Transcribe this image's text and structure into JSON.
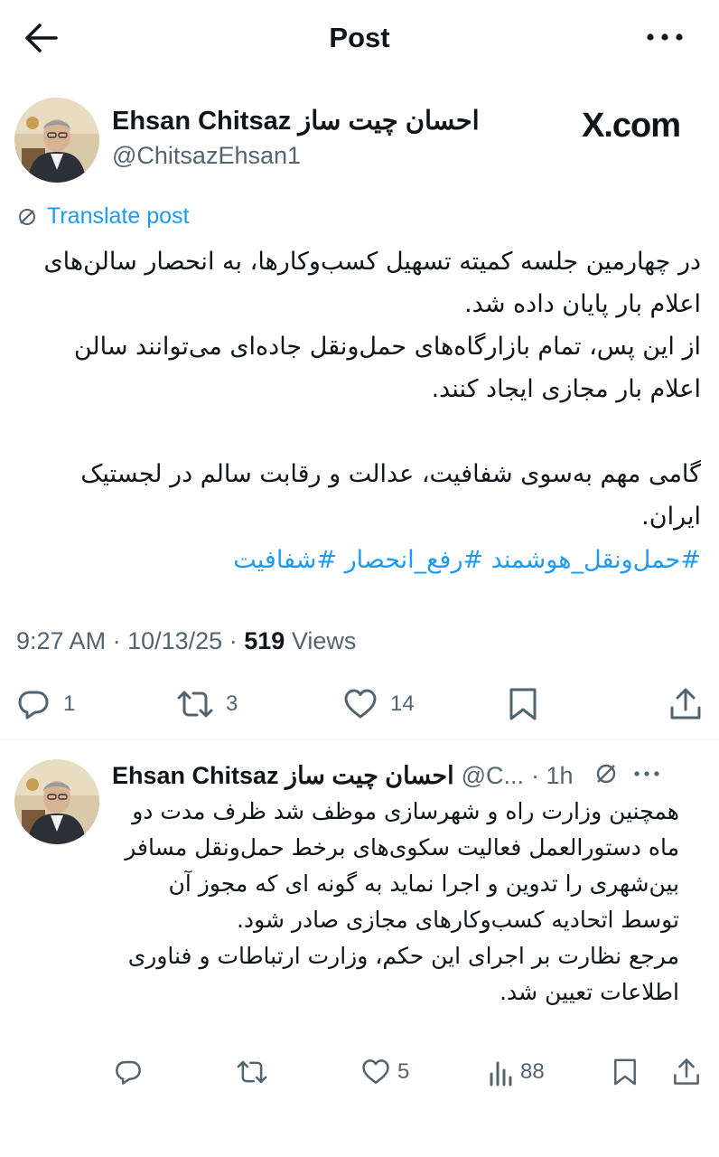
{
  "header": {
    "title": "Post"
  },
  "watermark": "X.com",
  "post": {
    "author_name": "Ehsan Chitsaz احسان چیت ساز",
    "author_handle": "@ChitsazEhsan1",
    "translate_label": "Translate post",
    "text": "در چهارمین جلسه کمیته تسهیل کسب‌وکارها، به انحصار سالن‌های اعلام بار پایان داده شد.\nاز این پس، تمام بازارگاه‌های حمل‌ونقل جاده‌ای می‌توانند سالن  اعلام بار مجازی ایجاد کنند.\n\nگامی مهم به‌سوی شفافیت، عدالت و رقابت سالم در لجستیک ایران.",
    "hashtags": [
      "#حمل‌ونقل_هوشمند",
      "#رفع_انحصار",
      "#شفافیت"
    ],
    "time": "9:27 AM",
    "date": "10/13/25",
    "views_count": "519",
    "views_label": "Views",
    "sep": "·",
    "replies": "1",
    "reposts": "3",
    "likes": "14"
  },
  "reply": {
    "author_name": "Ehsan Chitsaz احسان چیت ساز",
    "author_handle": "@C...",
    "time_ago": "· 1h",
    "text": "همچنین وزارت راه و شهرسازی موظف شد ظرف مدت دو ماه دستورالعمل فعالیت سکوی‌های برخط حمل‌ونقل مسافر بین‌شهری را تدوین و اجرا نماید به گونه ای که مجوز آن  توسط اتحادیه کسب‌وکارهای مجازی صادر شود.\nمرجع نظارت بر اجرای این حکم، وزارت ارتباطات و فناوری اطلاعات تعیین شد.",
    "replies": "",
    "reposts": "",
    "likes": "5",
    "views": "88"
  },
  "colors": {
    "accent": "#1d9bf0",
    "muted": "#536471",
    "text": "#0f1419"
  },
  "icons": [
    "back-arrow-icon",
    "more-icon",
    "translate-icon",
    "reply-icon",
    "repost-icon",
    "like-icon",
    "bookmark-icon",
    "share-icon",
    "grok-icon",
    "views-icon"
  ]
}
